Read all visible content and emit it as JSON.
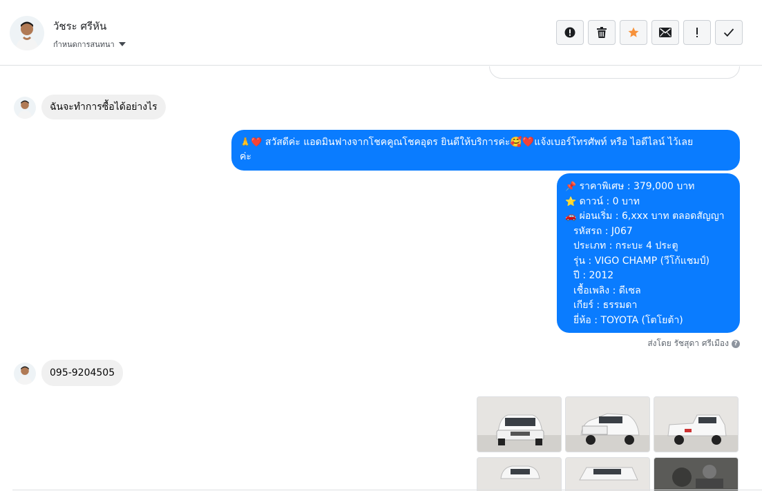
{
  "header": {
    "name": "วัชระ ศรีหัน",
    "assign_label": "กำหนดการสนทนา",
    "actions": [
      {
        "icon": "alert-circle-icon"
      },
      {
        "icon": "trash-icon"
      },
      {
        "icon": "star-icon",
        "color": "#f7923b"
      },
      {
        "icon": "envelope-icon"
      },
      {
        "icon": "exclamation-icon"
      },
      {
        "icon": "checkmark-icon"
      }
    ]
  },
  "messages": {
    "incoming_1": "ฉันจะทำการซื้อได้อย่างไร",
    "outgoing_1": {
      "prefix_emoji": "🙏❤️",
      "line1": "สวัสดีค่ะ แอดมินฟางจากโชคคูณโชคอุดร ยินดีให้บริการค่ะ🥰❤️แจ้งเบอร์โทรศัพท์ หรือ ไอดีไลน์  ไว้เลย",
      "line2": "ค่ะ"
    },
    "outgoing_2": {
      "price": "ราคาพิเศษ : 379,000 บาท",
      "down": "ดาวน์ : 0 บาท",
      "installment": "ผ่อนเริ่ม : 6,xxx บาท ตลอดสัญญา",
      "code": "รหัสรถ : J067",
      "type": "ประเภท : กระบะ 4 ประตู",
      "model": "รุ่น : VIGO CHAMP (วีโก้แชมป์)",
      "year": "ปี : 2012",
      "fuel": "เชื้อเพลิง : ดีเซล",
      "gear": "เกียร์ : ธรรมดา",
      "brand": "ยี่ห้อ : TOYOTA (โตโยต้า)"
    },
    "sender_note": "ส่งโดย รัชสุดา ศรีเมือง",
    "incoming_2": "095-9204505"
  },
  "colors": {
    "outgoing_bubble": "#0a7cff",
    "incoming_bubble": "#f0f0f0",
    "star": "#f7923b"
  }
}
